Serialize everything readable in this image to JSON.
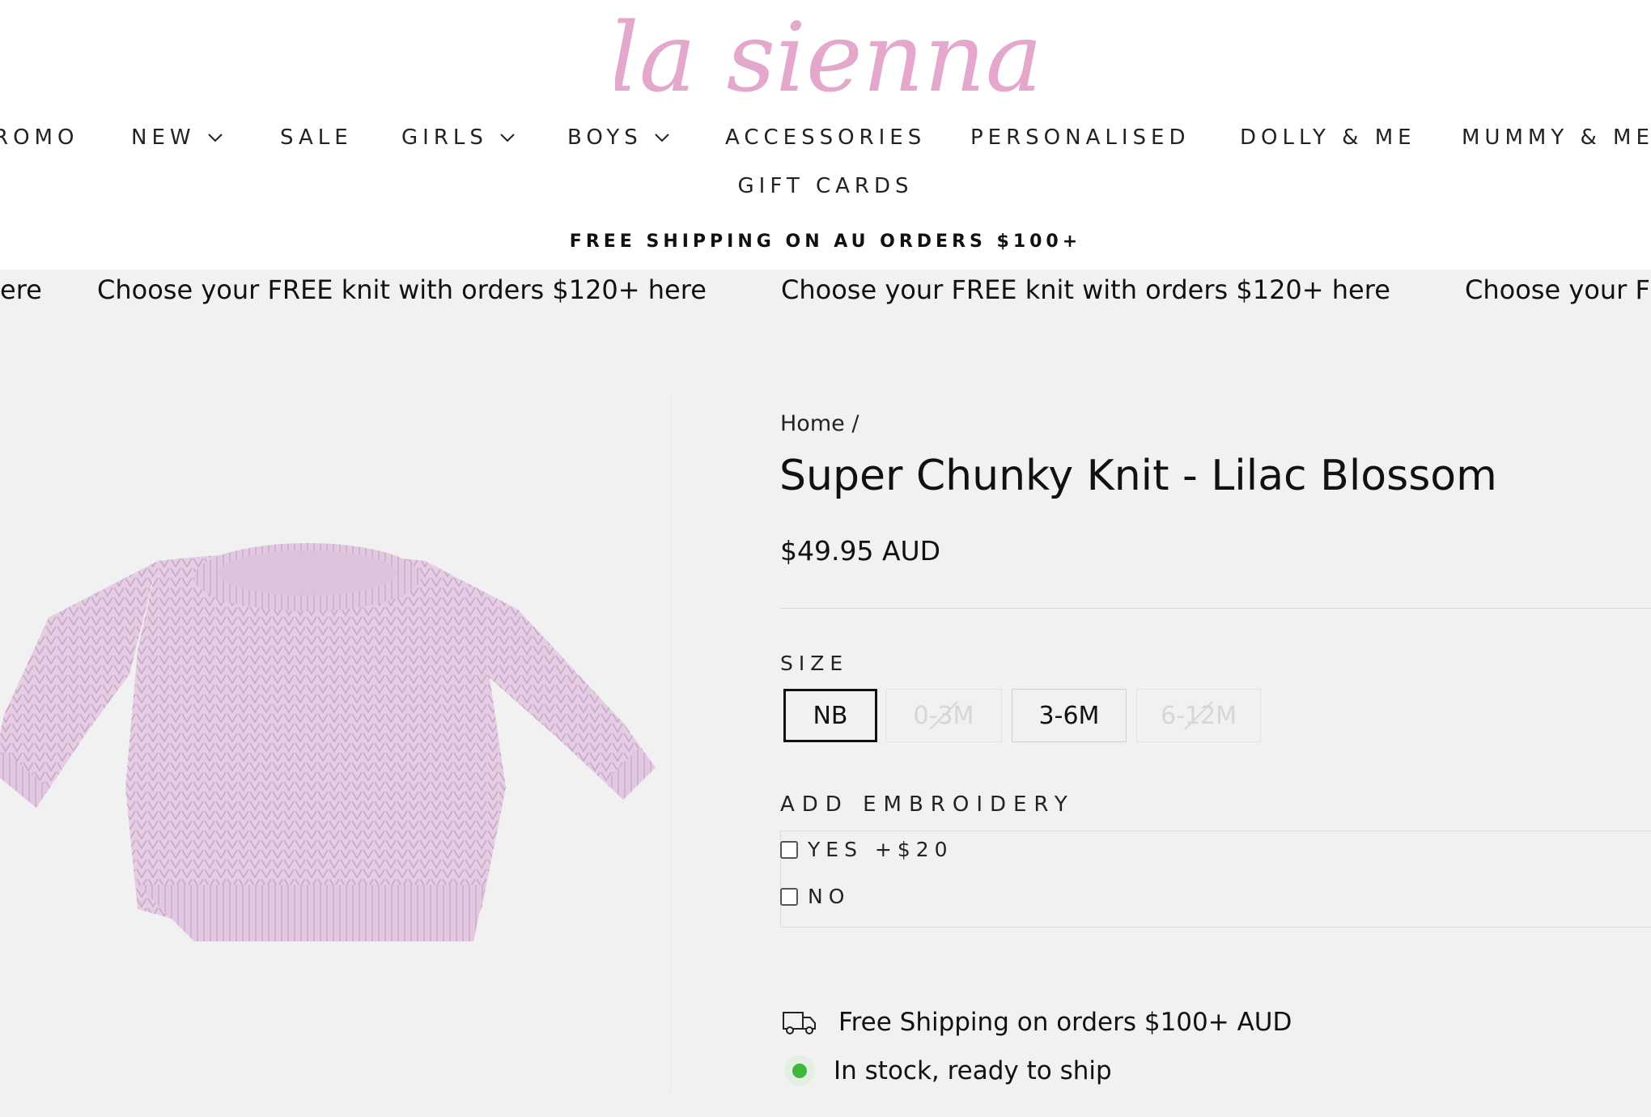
{
  "brand": {
    "name": "la sienna",
    "color": "#e3a8cc"
  },
  "nav": {
    "items": [
      {
        "label": "ROMO",
        "has_dropdown": false
      },
      {
        "label": "NEW",
        "has_dropdown": true
      },
      {
        "label": "SALE",
        "has_dropdown": false
      },
      {
        "label": "GIRLS",
        "has_dropdown": true
      },
      {
        "label": "BOYS",
        "has_dropdown": true
      },
      {
        "label": "ACCESSORIES",
        "has_dropdown": false
      },
      {
        "label": "PERSONALISED",
        "has_dropdown": false
      },
      {
        "label": "DOLLY & ME",
        "has_dropdown": false
      },
      {
        "label": "MUMMY & ME",
        "has_dropdown": false
      }
    ],
    "second_row": "GIFT CARDS"
  },
  "shipping_banner": "FREE SHIPPING ON AU ORDERS $100+",
  "marquee": {
    "fragment_left": "ere",
    "text": "Choose your FREE knit with orders $120+ here",
    "fragment_right": "Choose your F"
  },
  "breadcrumb": {
    "home": "Home",
    "separator": "/"
  },
  "product": {
    "title": "Super Chunky Knit - Lilac Blossom",
    "price": "$49.95 AUD",
    "image_color": "#e5cde3",
    "size_label": "SIZE",
    "sizes": [
      {
        "label": "NB",
        "state": "selected"
      },
      {
        "label": "0-3M",
        "state": "sold-out"
      },
      {
        "label": "3-6M",
        "state": "available"
      },
      {
        "label": "6-12M",
        "state": "sold-out"
      }
    ],
    "embroidery": {
      "label": "ADD EMBROIDERY",
      "options": [
        {
          "label": "YES +$20",
          "checked": false
        },
        {
          "label": "NO",
          "checked": false
        }
      ]
    },
    "shipping_note": "Free Shipping on orders $100+ AUD",
    "stock_status": "In stock, ready to ship",
    "stock_color": "#3cb83c"
  }
}
